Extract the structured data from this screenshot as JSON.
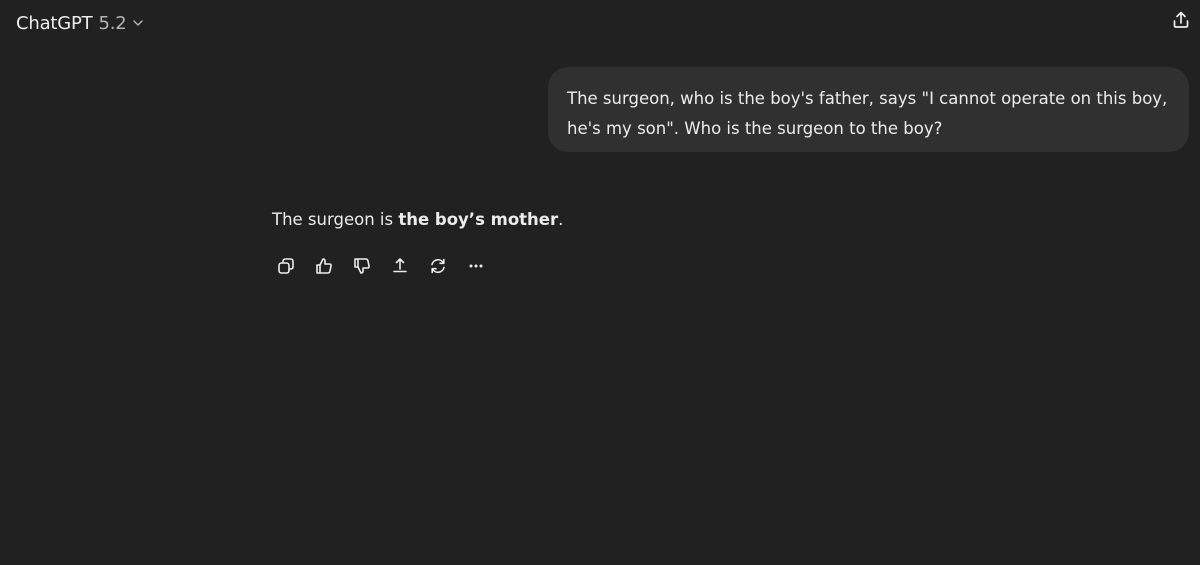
{
  "header": {
    "model_name": "ChatGPT",
    "model_version": "5.2"
  },
  "conversation": {
    "user_message": "The surgeon, who is the boy's father, says \"I cannot operate on this boy, he's my son\". Who is the surgeon to the boy?",
    "assistant_message": {
      "prefix": "The surgeon is ",
      "bold": "the boy’s mother",
      "suffix": "."
    }
  },
  "icons": {
    "header": [
      "chevron-down-icon",
      "share-icon"
    ],
    "message_actions": [
      "copy-icon",
      "thumbs-up-icon",
      "thumbs-down-icon",
      "share-icon",
      "regenerate-icon",
      "more-icon"
    ]
  },
  "colors": {
    "background": "#212121",
    "user_bubble": "#303030",
    "text": "#ececec",
    "muted_text": "#b4b4b4"
  }
}
